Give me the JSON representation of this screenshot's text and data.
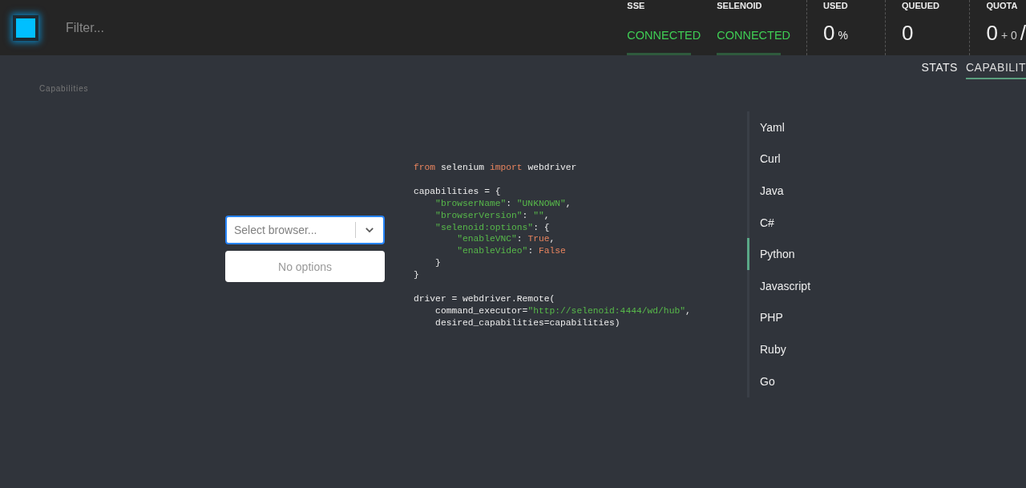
{
  "header": {
    "filter": {
      "placeholder": "Filter..."
    },
    "statuses": [
      {
        "label": "SSE",
        "value": "CONNECTED",
        "connected": true
      },
      {
        "label": "SELENOID",
        "value": "CONNECTED",
        "connected": true
      }
    ],
    "used": {
      "label": "USED",
      "value": "0",
      "unit": "%"
    },
    "queued": {
      "label": "QUEUED",
      "value": "0"
    },
    "quota": {
      "label": "QUOTA",
      "value": "0",
      "extra": "+ 0",
      "separator": "/"
    }
  },
  "tabs": [
    {
      "label": "STATS",
      "selected": false
    },
    {
      "label": "CAPABILIT",
      "selected": true
    }
  ],
  "breadcrumb": "Capabilities",
  "browser_select": {
    "placeholder": "Select browser...",
    "menu": "No options"
  },
  "code_blocks": [
    [
      [
        {
          "kind": "keyword",
          "text": "from"
        },
        {
          "kind": "plain",
          "text": " selenium "
        },
        {
          "kind": "keyword",
          "text": "import"
        },
        {
          "kind": "plain",
          "text": " webdriver"
        }
      ]
    ],
    [
      [
        {
          "kind": "plain",
          "text": "capabilities = {"
        }
      ],
      [
        {
          "kind": "string",
          "text": "    \"browserName\""
        },
        {
          "kind": "plain",
          "text": ": "
        },
        {
          "kind": "string",
          "text": "\"UNKNOWN\""
        },
        {
          "kind": "plain",
          "text": ","
        }
      ],
      [
        {
          "kind": "string",
          "text": "    \"browserVersion\""
        },
        {
          "kind": "plain",
          "text": ": "
        },
        {
          "kind": "string",
          "text": "\"\""
        },
        {
          "kind": "plain",
          "text": ","
        }
      ],
      [
        {
          "kind": "string",
          "text": "    \"selenoid:options\""
        },
        {
          "kind": "plain",
          "text": ": {"
        }
      ],
      [
        {
          "kind": "string",
          "text": "        \"enableVNC\""
        },
        {
          "kind": "plain",
          "text": ": "
        },
        {
          "kind": "keyword",
          "text": "True"
        },
        {
          "kind": "plain",
          "text": ","
        }
      ],
      [
        {
          "kind": "string",
          "text": "        \"enableVideo\""
        },
        {
          "kind": "plain",
          "text": ": "
        },
        {
          "kind": "keyword",
          "text": "False"
        }
      ],
      [
        {
          "kind": "plain",
          "text": "    }"
        }
      ],
      [
        {
          "kind": "plain",
          "text": "}"
        }
      ]
    ],
    [
      [
        {
          "kind": "plain",
          "text": "driver = webdriver.Remote("
        }
      ],
      [
        {
          "kind": "plain",
          "text": "    command_executor="
        },
        {
          "kind": "string",
          "text": "\"http://selenoid:4444/wd/hub\""
        },
        {
          "kind": "plain",
          "text": ","
        }
      ],
      [
        {
          "kind": "plain",
          "text": "    desired_capabilities=capabilities)"
        }
      ]
    ]
  ],
  "languages": [
    {
      "label": "Yaml",
      "selected": false
    },
    {
      "label": "Curl",
      "selected": false
    },
    {
      "label": "Java",
      "selected": false
    },
    {
      "label": "C#",
      "selected": false
    },
    {
      "label": "Python",
      "selected": true
    },
    {
      "label": "Javascript",
      "selected": false
    },
    {
      "label": "PHP",
      "selected": false
    },
    {
      "label": "Ruby",
      "selected": false
    },
    {
      "label": "Go",
      "selected": false
    }
  ]
}
